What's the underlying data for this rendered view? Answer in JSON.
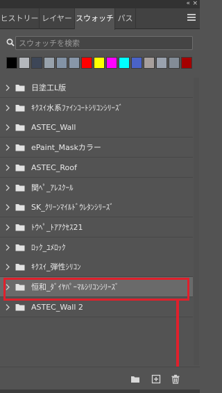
{
  "panel": {
    "collapse_glyph": "«",
    "close_glyph": "×"
  },
  "tabs": [
    {
      "label": "ヒストリー"
    },
    {
      "label": "レイヤー"
    },
    {
      "label": "スウォッチ"
    },
    {
      "label": "パス"
    }
  ],
  "active_tab": "スウォッチ",
  "search": {
    "placeholder": "スウォッチを検索",
    "value": ""
  },
  "swatches": [
    {
      "color": "#000000"
    },
    {
      "color": "#b4b7bc"
    },
    {
      "color": "#3d4657"
    },
    {
      "color": "#98a2ac"
    },
    {
      "color": "#8393a6"
    },
    {
      "color": "#8897a9"
    },
    {
      "color": "#ff0000"
    },
    {
      "color": "#ffff00"
    },
    {
      "color": "#ff00ff"
    },
    {
      "color": "#00ffff"
    },
    {
      "color": "#4a63c8"
    },
    {
      "color": "#a79f9c"
    },
    {
      "color": "#9aa2ae"
    },
    {
      "color": "#838c97"
    },
    {
      "color": "#a40000"
    }
  ],
  "folders": [
    {
      "label": "日塗工L版"
    },
    {
      "label": "ｷｸｽｲ水系ﾌｧｲﾝｺｰﾄｼﾘｺﾝｼﾘｰｽﾞ"
    },
    {
      "label": "ASTEC_Wall"
    },
    {
      "label": "ePaint_Maskカラー"
    },
    {
      "label": "ASTEC_Roof"
    },
    {
      "label": "関ﾍﾟ_ｱﾚｽｸｰﾙ"
    },
    {
      "label": "SK_ｸﾘｰﾝﾏｲﾙﾄﾞｳﾚﾀﾝｼﾘｰｽﾞ"
    },
    {
      "label": "ﾄｳﾍﾟ_ﾄｱｱｸｾｽ21"
    },
    {
      "label": "ﾛｯｸ_ﾕﾒﾛｯｸ"
    },
    {
      "label": "ｷｸｽｲ_弾性ｼﾘｺﾝ"
    },
    {
      "label": "恒和_ﾀﾞｲﾔﾊﾟｰﾏﾙｼﾘｺﾝｼﾘｰｽﾞ"
    },
    {
      "label": "ASTEC_Wall 2"
    }
  ],
  "selected_folder": "恒和_ﾀﾞｲﾔﾊﾟｰﾏﾙｼﾘｺﾝｼﾘｰｽﾞ",
  "bottom_buttons": [
    {
      "icon": "folder-icon"
    },
    {
      "icon": "add-icon"
    },
    {
      "icon": "trash-icon"
    }
  ],
  "colors": {
    "panel_bg": "#535353",
    "selected_row": "#6a6a6a",
    "highlight": "#e0202c"
  }
}
